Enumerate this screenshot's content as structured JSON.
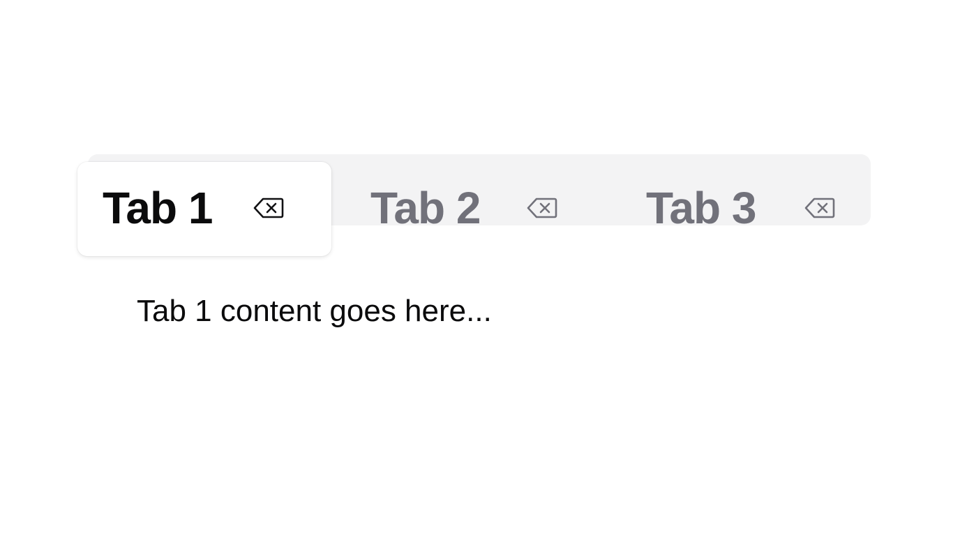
{
  "tabs": [
    {
      "label": "Tab 1",
      "active": true,
      "close_icon": "delete-backspace-icon"
    },
    {
      "label": "Tab 2",
      "active": false,
      "close_icon": "delete-backspace-icon"
    },
    {
      "label": "Tab 3",
      "active": false,
      "close_icon": "delete-backspace-icon"
    }
  ],
  "content": {
    "text": "Tab 1 content goes here..."
  },
  "colors": {
    "active_text": "#0b0b0c",
    "inactive_text": "#71717a",
    "strip_background": "#f3f3f4",
    "active_tab_background": "#ffffff"
  }
}
